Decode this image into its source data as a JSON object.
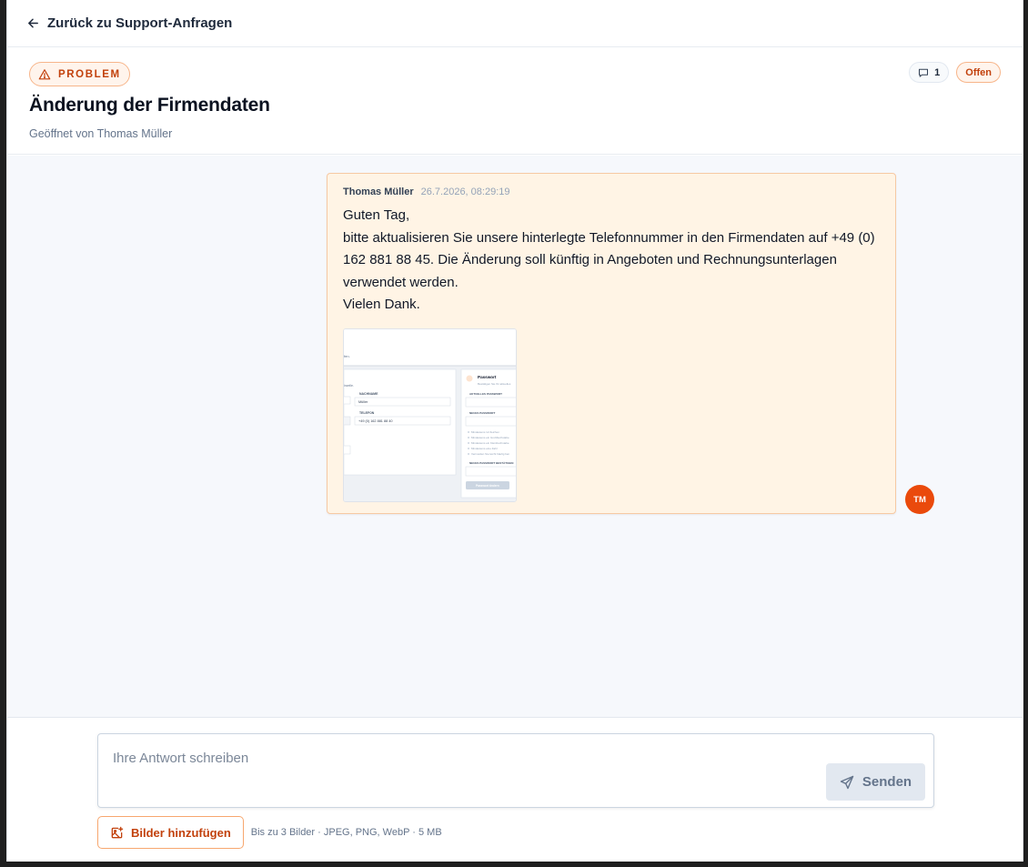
{
  "nav": {
    "back_label": "Zurück zu Support-Anfragen"
  },
  "ticket": {
    "type_badge": "PROBLEM",
    "title": "Änderung der Firmendaten",
    "opened_by": "Geöffnet von Thomas Müller",
    "comment_count": "1",
    "status": "Offen"
  },
  "messages": [
    {
      "author": "Thomas Müller",
      "timestamp": "26.7.2026, 08:29:19",
      "lines": [
        "Guten Tag,",
        "bitte aktualisieren Sie unsere hinterlegte Telefonnummer in den Firmendaten auf +49 (0) 162 881 88 45. Die Änderung soll künftig in Angeboten und Rechnungsunterlagen verwendet werden.",
        "Vielen Dank."
      ],
      "avatar_initials": "TM",
      "attachment": {
        "fragment_top": "fen.",
        "left_hint": "inzelle.",
        "nachname_label": "NACHNAME",
        "nachname_value": "Müller",
        "telefon_label": "TELEFON",
        "telefon_value": "+49 (0) 162 881 88 40",
        "pw_title": "Passwort",
        "pw_sub": "Bestätigen Sie Ihr aktuelles",
        "pw_current_label": "AKTUELLES PASSWORT",
        "pw_new_label": "NEUES PASSWORT",
        "rules": [
          "Mindestens 12 Zeichen",
          "Mindestens ein Großbuchstabe",
          "Mindestens ein Kleinbuchstabe",
          "Mindestens eine Zahl",
          "Vermeiden Sie leicht häufig ben"
        ],
        "pw_confirm_label": "NEUES PASSWORT BESTÄTIGEN",
        "pw_button": "Passwort ändern"
      }
    }
  ],
  "composer": {
    "placeholder": "Ihre Antwort schreiben",
    "send_label": "Senden",
    "upload_label": "Bilder hinzufügen",
    "upload_hint": "Bis zu 3 Bilder · JPEG, PNG, WebP · 5 MB"
  },
  "colors": {
    "accent": "#c2410c",
    "avatar": "#ea4a0c",
    "bubble_bg": "#fff4e5",
    "thread_bg": "#f6f8fc"
  }
}
